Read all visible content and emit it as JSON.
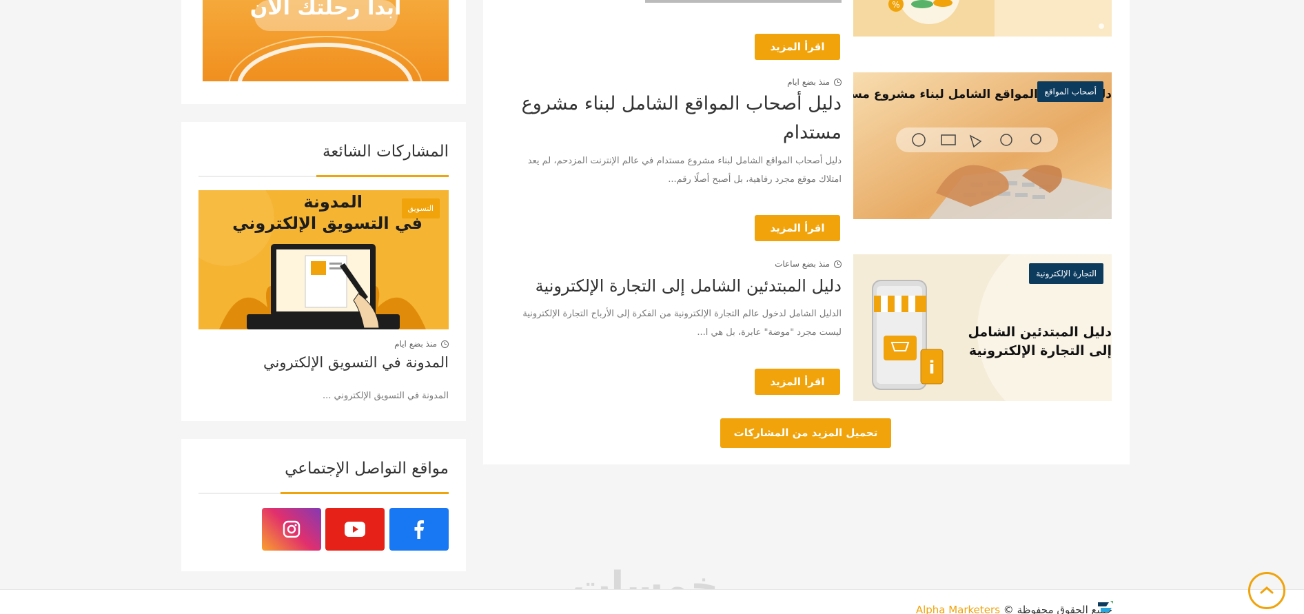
{
  "sidebar": {
    "top_banner_text": "ابدأ رحلتك الآن",
    "popular": {
      "title": "المشاركات الشائعة",
      "post": {
        "category": "التسويق",
        "image_title_line1": "المدونة",
        "image_title_line2": "في التسويق الإلكتروني",
        "time": "منذ بضع ايام",
        "title": "المدونة في التسويق الإلكتروني",
        "excerpt": "المدونة في التسويق الإلكتروني ..."
      }
    },
    "social": {
      "title": "مواقع التواصل الإجتماعي",
      "items": [
        {
          "name": "facebook",
          "icon": "facebook-icon",
          "color": "#1877f2"
        },
        {
          "name": "youtube",
          "icon": "youtube-icon",
          "color": "#e62117"
        },
        {
          "name": "instagram",
          "icon": "instagram-icon",
          "color": "#d6249f"
        }
      ]
    }
  },
  "main": {
    "posts": [
      {
        "time": "",
        "read_more": "اقرأ المزيد"
      },
      {
        "category": "أصحاب المواقع",
        "image_caption": "دليل أصحاب المواقع الشامل لبناء مشروع مستدام",
        "time": "منذ بضع ايام",
        "title": "دليل أصحاب المواقع الشامل لبناء مشروع مستدام",
        "excerpt": "دليل أصحاب المواقع الشامل لبناء مشروع مستدام في عالم الإنترنت المزدحم، لم يعد امتلاك موقع مجرد رفاهية، بل أصبح أصلًا رقم...",
        "read_more": "اقرأ المزيد"
      },
      {
        "category": "التجارة الإلكترونية",
        "image_caption_line1": "دليل المبتدئين الشامل",
        "image_caption_line2": "إلى التجارة الإلكترونية",
        "time": "منذ بضع ساعات",
        "title": "دليل المبتدئين الشامل إلى التجارة الإلكترونية",
        "excerpt": "الدليل الشامل لدخول عالم التجارة الإلكترونية من الفكرة إلى الأرباح التجارة الإلكترونية ليست مجرد \"موضة\" عابرة، بل هي ا...",
        "read_more": "اقرأ المزيد"
      }
    ],
    "load_more": "تحميل المزيد من المشاركات"
  },
  "footer": {
    "copyright": "جميع الحقوق محفوظة ©",
    "brand": "Alpha Marketers",
    "watermark": "خمسات"
  },
  "colors": {
    "accent": "#f0a30a",
    "badge": "#0d3b5e"
  }
}
